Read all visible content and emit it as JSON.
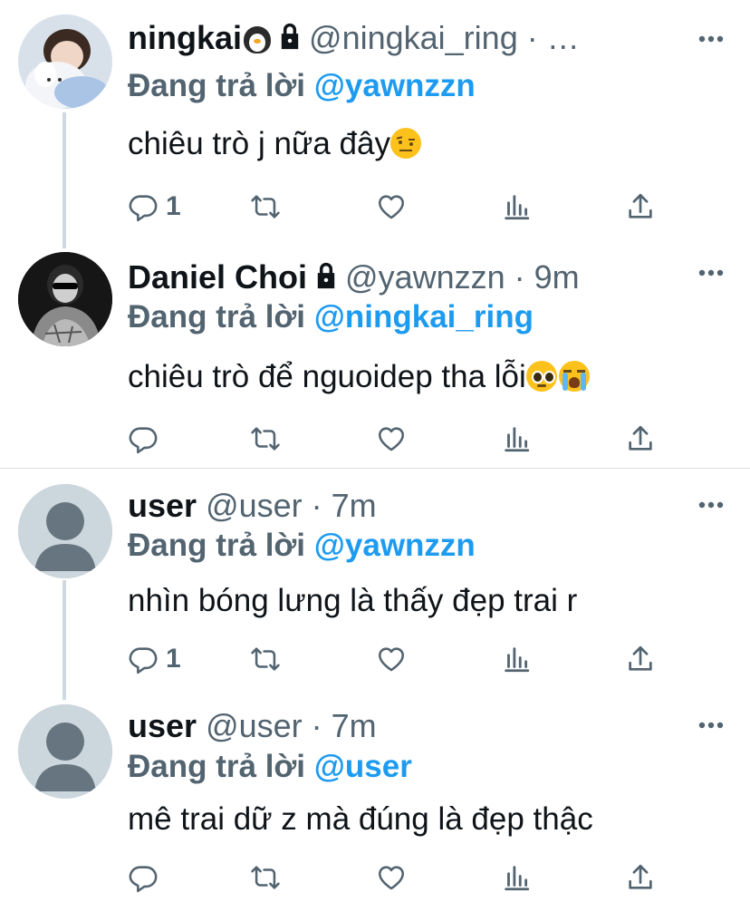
{
  "tweets": [
    {
      "name": "ningkai",
      "name_emoji": "penguin-emoji",
      "locked": true,
      "handle": "@ningkai_ring",
      "meta": "· …",
      "reply_prefix": "Đang trả lời",
      "reply_to": "@yawnzzn",
      "text": "chiêu trò j nữa đây",
      "text_emoji": "raised-eyebrow-emoji",
      "reply_count": "1"
    },
    {
      "name": "Daniel Choi",
      "locked": true,
      "handle": "@yawnzzn",
      "meta": "· 9m",
      "reply_prefix": "Đang trả lời",
      "reply_to": "@ningkai_ring",
      "text": "chiêu trò để nguoidep tha lỗi",
      "text_emoji": "pleading-and-crying-emoji",
      "reply_count": ""
    },
    {
      "name": "user",
      "locked": false,
      "handle": "@user",
      "meta": "· 7m",
      "reply_prefix": "Đang trả lời",
      "reply_to": "@yawnzzn",
      "text": "nhìn bóng lưng là thấy đẹp trai r",
      "reply_count": "1"
    },
    {
      "name": "user",
      "locked": false,
      "handle": "@user",
      "meta": "· 7m",
      "reply_prefix": "Đang trả lời",
      "reply_to": "@user",
      "text": "mê trai dữ z mà đúng là đẹp thậc",
      "reply_count": ""
    }
  ],
  "colors": {
    "accent": "#1d9bf0",
    "secondary_text": "#536471",
    "primary_text": "#0f1419",
    "thread_line": "#cfd9de"
  },
  "icons": [
    "reply-icon",
    "retweet-icon",
    "like-icon",
    "analytics-icon",
    "share-icon",
    "more-icon",
    "lock-icon"
  ]
}
